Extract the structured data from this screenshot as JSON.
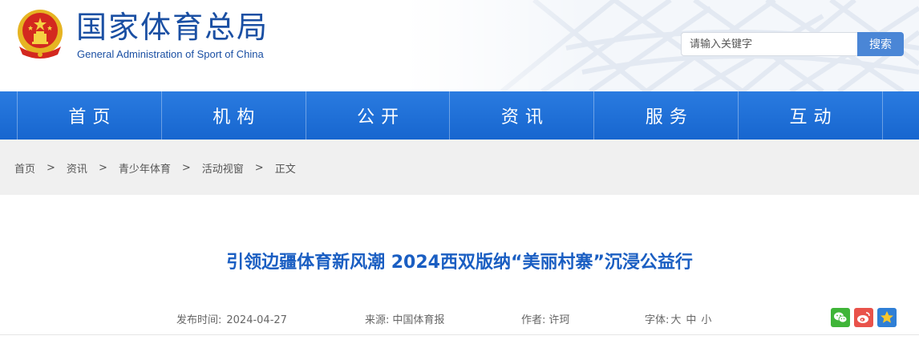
{
  "header": {
    "title": "国家体育总局",
    "subtitle": "General Administration of Sport of China",
    "search_placeholder": "请输入关键字",
    "search_button": "搜索"
  },
  "nav": {
    "items": [
      {
        "label": "首页"
      },
      {
        "label": "机构"
      },
      {
        "label": "公开"
      },
      {
        "label": "资讯"
      },
      {
        "label": "服务"
      },
      {
        "label": "互动"
      }
    ]
  },
  "breadcrumb": {
    "items": [
      "首页",
      "资讯",
      "青少年体育",
      "活动视窗",
      "正文"
    ],
    "separator": ">"
  },
  "article": {
    "title": "引领边疆体育新风潮 2024西双版纳“美丽村寨”沉浸公益行",
    "publish_label": "发布时间:",
    "publish_date": "2024-04-27",
    "source_label": "来源:",
    "source": "中国体育报",
    "author_label": "作者:",
    "author": "许珂",
    "font_label": "字体:",
    "font_large": "大",
    "font_medium": "中",
    "font_small": "小"
  },
  "share": {
    "icons": [
      "wechat-icon",
      "weibo-icon",
      "favorite-star-icon"
    ]
  },
  "colors": {
    "brand_blue": "#1a4fa3",
    "nav_blue": "#1f70d8",
    "title_blue": "#1a5ec2",
    "search_button": "#4a86d6"
  }
}
